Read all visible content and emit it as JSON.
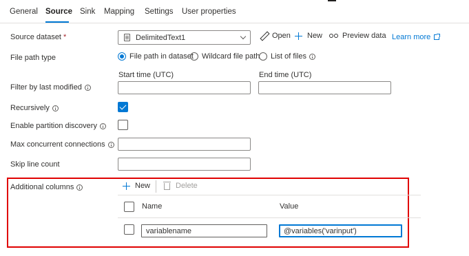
{
  "tabs": [
    {
      "label": "General"
    },
    {
      "label": "Source"
    },
    {
      "label": "Sink"
    },
    {
      "label": "Mapping"
    },
    {
      "label": "Settings"
    },
    {
      "label": "User properties"
    }
  ],
  "active_tab": "Source",
  "source_dataset": {
    "label": "Source dataset",
    "required_mark": "*",
    "selected": "DelimitedText1",
    "open_label": "Open",
    "new_label": "New",
    "preview_label": "Preview data",
    "learn_more_label": "Learn more"
  },
  "file_path_type": {
    "label": "File path type",
    "options": [
      {
        "label": "File path in dataset",
        "selected": true
      },
      {
        "label": "Wildcard file path",
        "selected": false
      },
      {
        "label": "List of files",
        "selected": false
      }
    ]
  },
  "filter_last_modified": {
    "label": "Filter by last modified",
    "start_label": "Start time (UTC)",
    "end_label": "End time (UTC)",
    "start_value": "",
    "end_value": ""
  },
  "recursively": {
    "label": "Recursively",
    "checked": true
  },
  "partition_discovery": {
    "label": "Enable partition discovery",
    "checked": false
  },
  "max_concurrent": {
    "label": "Max concurrent connections",
    "value": ""
  },
  "skip_line_count": {
    "label": "Skip line count",
    "value": ""
  },
  "additional_columns": {
    "label": "Additional columns",
    "new_label": "New",
    "delete_label": "Delete",
    "headers": {
      "name": "Name",
      "value": "Value"
    },
    "rows": [
      {
        "name": "variablename",
        "value": "@variables('varinput')"
      }
    ]
  },
  "colors": {
    "accent": "#0078d4",
    "highlight_border": "#e00000"
  }
}
